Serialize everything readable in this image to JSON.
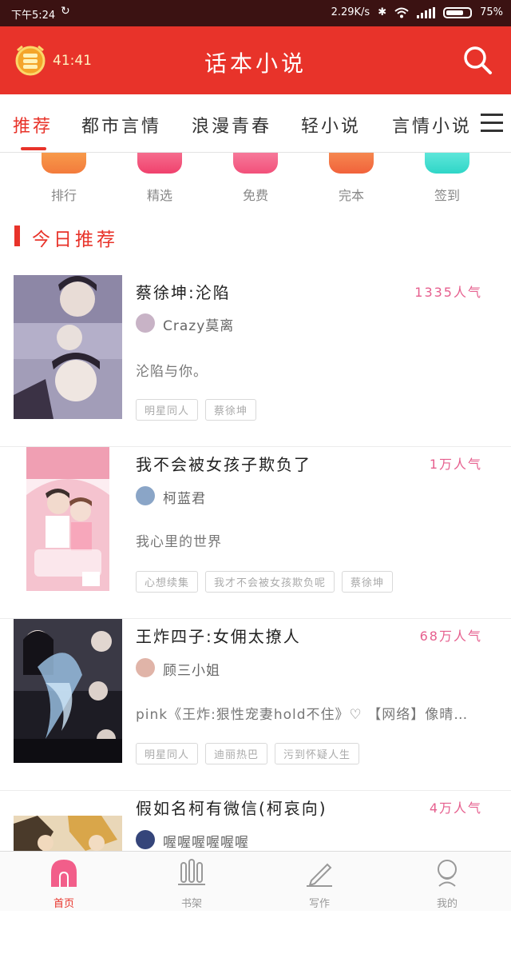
{
  "status_bar": {
    "time": "下午5:24",
    "speed": "2.29K/s",
    "battery": "75%",
    "battery_level": 0.75
  },
  "header": {
    "timer": "41:41",
    "title": "话本小说",
    "colors": {
      "header_bg": "#e8332a",
      "accent": "#e8332a",
      "popularity": "#e65f8e"
    }
  },
  "tabs": [
    {
      "label": "推荐",
      "active": true
    },
    {
      "label": "都市言情"
    },
    {
      "label": "浪漫青春"
    },
    {
      "label": "轻小说"
    },
    {
      "label": "言情小说"
    }
  ],
  "quick_entries": [
    {
      "label": "排行",
      "icon": "ranking-icon",
      "color": "#f37b3c"
    },
    {
      "label": "精选",
      "icon": "star-icon",
      "color": "#f0416d"
    },
    {
      "label": "免费",
      "icon": "free-icon",
      "color": "#f2507a"
    },
    {
      "label": "完本",
      "icon": "book-icon",
      "color": "#f1623b"
    },
    {
      "label": "签到",
      "icon": "checkin-icon",
      "color": "#2fd6c7"
    }
  ],
  "section": {
    "title": "今日推荐"
  },
  "books": [
    {
      "title": "蔡徐坤:沦陷",
      "popularity": "1335人气",
      "author": "Crazy莫离",
      "description": "沦陷与你。",
      "tags": [
        "明星同人",
        "蔡徐坤"
      ]
    },
    {
      "title": "我不会被女孩子欺负了",
      "popularity": "1万人气",
      "author": "柯蓝君",
      "description": "我心里的世界",
      "tags": [
        "心想续集",
        "我才不会被女孩欺负呢",
        "蔡徐坤"
      ]
    },
    {
      "title": "王炸四子:女佣太撩人",
      "popularity": "68万人气",
      "author": "顾三小姐",
      "description": "pink《王炸:狠性宠妻hold不住》♡ 【网络】像晴…",
      "tags": [
        "明星同人",
        "迪丽热巴",
        "污到怀疑人生"
      ]
    },
    {
      "title": "假如名柯有微信(柯哀向)",
      "popularity": "4万人气",
      "author": "喔喔喔喔喔喔",
      "description": "",
      "tags": []
    }
  ],
  "bottom_nav": [
    {
      "label": "首页",
      "icon": "home-icon",
      "active": true
    },
    {
      "label": "书架",
      "icon": "bookshelf-icon"
    },
    {
      "label": "写作",
      "icon": "pen-icon"
    },
    {
      "label": "我的",
      "icon": "profile-icon"
    }
  ]
}
